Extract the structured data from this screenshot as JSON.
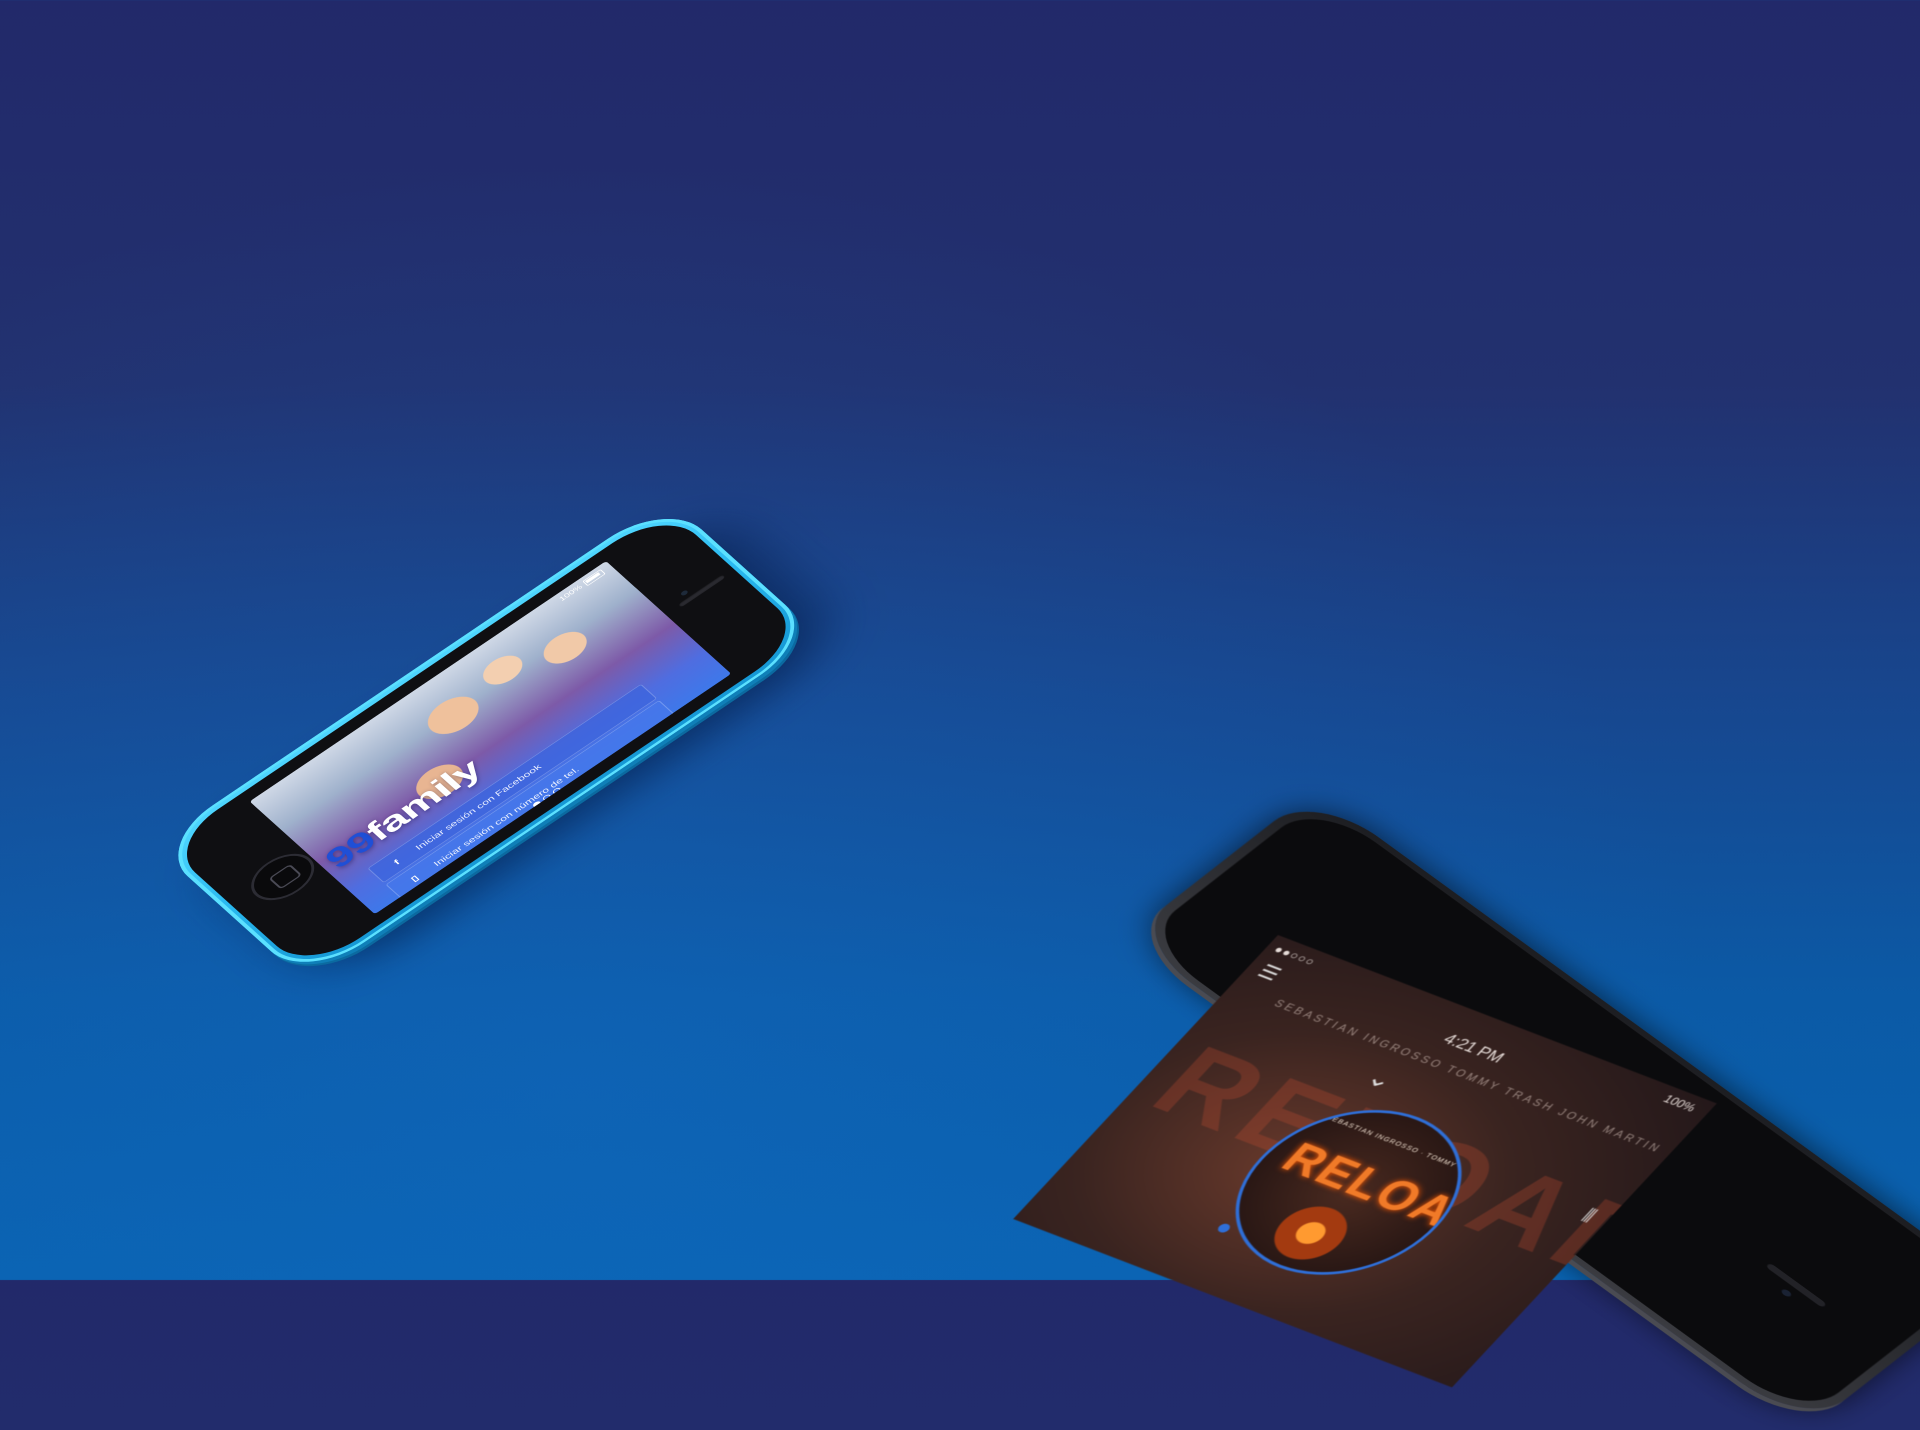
{
  "phone1": {
    "battery_text": "100%",
    "logo_num": "99",
    "logo_word": "family",
    "buttons": {
      "facebook_icon": "f",
      "facebook_label": "Iniciar sesión con Facebook",
      "phone_icon": "▯",
      "phone_label": "Iniciar sesión con número de tel."
    },
    "page_dots": 3,
    "active_dot": 0
  },
  "phone2": {
    "signal": "●●○○○",
    "time": "4:21 PM",
    "battery_text": "100%",
    "menu_icon": "☰",
    "artists": "SEBASTIAN INGROSSO   TOMMY TRASH   JOHN MARTIN",
    "big_title": "RELOAD",
    "chevron": "⌄",
    "disc_title": "RELOAD",
    "disc_artists": "SEBASTIAN INGROSSO · TOMMY TRASH · JOHN MARTIN",
    "eq_icon": "⫼"
  },
  "colors": {
    "background_top": "#22296a",
    "background_bottom": "#0962b0",
    "phone1_shell": "#2ab9f0",
    "progress_accent": "#2f6fd8"
  }
}
